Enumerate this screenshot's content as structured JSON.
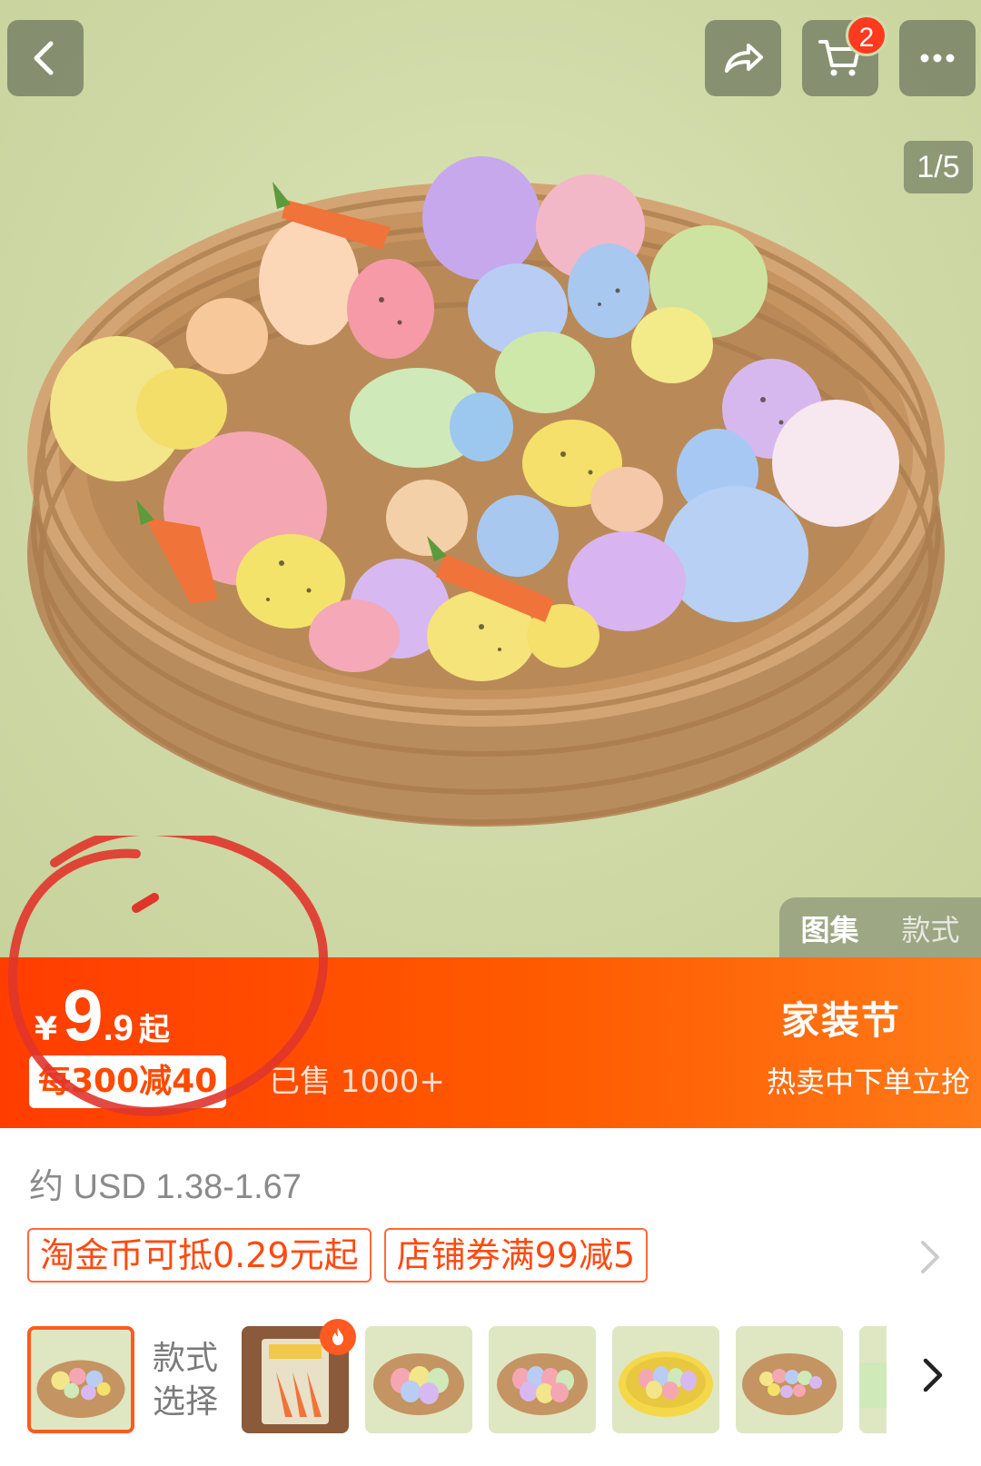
{
  "header": {
    "cart_badge": "2",
    "image_counter": "1/5",
    "icons": [
      "back-icon",
      "share-icon",
      "cart-icon",
      "more-icon"
    ]
  },
  "view_tabs": [
    {
      "label": "图集",
      "active": true
    },
    {
      "label": "款式",
      "active": false
    }
  ],
  "price": {
    "currency": "¥",
    "integer": "9",
    "decimal": ".9",
    "suffix": "起",
    "promo": "每300减40",
    "sold": "已售 1000+"
  },
  "festival": {
    "title": "家装节",
    "subtitle": "热卖中下单立抢"
  },
  "usd_price": "约 USD 1.38-1.67",
  "coupons": [
    "淘金币可抵0.29元起",
    "店铺券满99减5"
  ],
  "variant": {
    "label": "款式选择",
    "label_line1": "款式",
    "label_line2": "选择"
  },
  "colors": {
    "banner_start": "#ff3d00",
    "banner_end": "#ff7a18",
    "accent": "#ff4a10",
    "badge": "#ff3a1f",
    "annotation": "#e0352b"
  }
}
